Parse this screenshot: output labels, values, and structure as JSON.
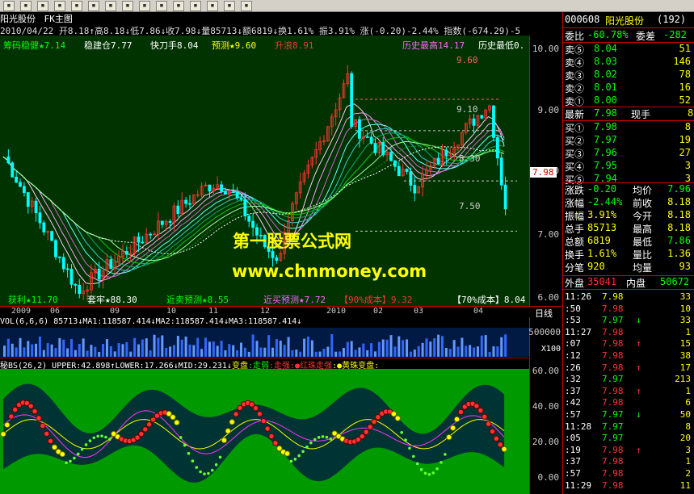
{
  "toolbar": {
    "buttons": [
      "back-icon",
      "forward-icon",
      "period-icon",
      "bars-icon",
      "zoom-in-icon",
      "zoom-out-icon",
      "cross-icon",
      "grid-icon",
      "line-icon",
      "rect-icon",
      "text-icon",
      "arrow-icon",
      "color-icon",
      "save-icon",
      "dropdown-icon"
    ]
  },
  "title": {
    "stock": "阳光股份",
    "indicator": "FK主图"
  },
  "info": {
    "text": "2010/04/22 开8.18↑高8.18↓低7.86↓收7.98↓量85713↓额6819↓换1.61% 振3.91% 涨(-0.20)-2.44% 指数(-674.29)-5"
  },
  "main_labels": {
    "row1": [
      {
        "t": "筹码稳健★7.14",
        "c": "#00ff00"
      },
      {
        "t": "稳建仓7.77",
        "c": "#ffffff"
      },
      {
        "t": "快刀手8.04",
        "c": "#ffffff"
      },
      {
        "t": "预测★9.60",
        "c": "#ffff00"
      },
      {
        "t": "升浪8.91",
        "c": "#ff3333"
      },
      {
        "t": "历史最高14.17",
        "c": "#ff66ff"
      },
      {
        "t": "历史最低0.",
        "c": "#ffffff"
      }
    ],
    "level_top": "9.60",
    "level_mid": "9.10",
    "level_83": "8.30",
    "level_low": "7.50",
    "bottom_row": [
      {
        "t": "获利★11.70",
        "c": "#00ff00"
      },
      {
        "t": "套牢★88.30",
        "c": "#ffffff"
      },
      {
        "t": "近卖预测★8.55",
        "c": "#00ff00"
      },
      {
        "t": "近买预测★7.72",
        "c": "#ff66ff"
      },
      {
        "t": "【90%成本】9.32",
        "c": "#ff3333"
      },
      {
        "t": "【70%成本】8.04",
        "c": "#ffffff"
      }
    ],
    "current_price_tag": "7.98"
  },
  "watermark": {
    "line1": "第一股票公式网",
    "line2": "www.chnmoney.com"
  },
  "y_axis_main": [
    "10.00",
    "9.00",
    "8.00",
    "7.00",
    "6.00"
  ],
  "date_axis": {
    "labels": [
      "2009",
      "06",
      "09",
      "10",
      "11",
      "12",
      "2010",
      "02",
      "03",
      "04"
    ],
    "period": "日线"
  },
  "vol": {
    "text": "VOL(6,6,6) 85713↓MA1:118587.414↓MA2:118587.414↓MA3:118587.414↓",
    "axis": "500000",
    "unit": "X100"
  },
  "bs": {
    "text_prefix": "秘BS(26,2) UPPER:42.898↑LOWER:17.266↓MID:29.231↓",
    "text_a": "变盘",
    "text_b": ":走弱",
    "text_c": ":走强",
    "text_d": ":●红珠走强",
    "text_e": ":●黄珠变盘:",
    "axis": [
      "60.00",
      "40.00",
      "20.00",
      "0.00"
    ]
  },
  "quote": {
    "code": "000608",
    "name": "阳光股份",
    "num": "(192)",
    "weibi_label": "委比",
    "weibi": "-60.78%",
    "weicha_label": "委差",
    "weicha": "-282",
    "sells": [
      {
        "label": "卖⑤",
        "price": "8.04",
        "vol": "51"
      },
      {
        "label": "卖④",
        "price": "8.03",
        "vol": "146"
      },
      {
        "label": "卖③",
        "price": "8.02",
        "vol": "78"
      },
      {
        "label": "卖②",
        "price": "8.01",
        "vol": "16"
      },
      {
        "label": "卖①",
        "price": "8.00",
        "vol": "52"
      }
    ],
    "latest_label": "最新",
    "latest": "7.98",
    "xianshou_label": "现手",
    "xianshou": "8",
    "buys": [
      {
        "label": "买①",
        "price": "7.98",
        "vol": "8"
      },
      {
        "label": "买②",
        "price": "7.97",
        "vol": "19"
      },
      {
        "label": "买③",
        "price": "7.96",
        "vol": "27"
      },
      {
        "label": "买④",
        "price": "7.95",
        "vol": "3"
      },
      {
        "label": "买⑤",
        "price": "7.94",
        "vol": "3"
      }
    ],
    "stats": [
      {
        "l1": "涨跌",
        "v1": "-0.20",
        "l2": "均价",
        "v2": "7.96"
      },
      {
        "l1": "涨幅",
        "v1": "-2.44%",
        "l2": "前收",
        "v2": "8.18"
      },
      {
        "l1": "振幅",
        "v1": "3.91%",
        "l2": "今开",
        "v2": "8.18"
      },
      {
        "l1": "总手",
        "v1": "85713",
        "l2": "最高",
        "v2": "8.18"
      },
      {
        "l1": "总额",
        "v1": "6819",
        "l2": "最低",
        "v2": "7.86"
      },
      {
        "l1": "换手",
        "v1": "1.61%",
        "l2": "量比",
        "v2": "1.36"
      },
      {
        "l1": "分笔",
        "v1": "920",
        "l2": "均量",
        "v2": "93"
      }
    ],
    "waipan_label": "外盘",
    "waipan": "35041",
    "neipan_label": "内盘",
    "neipan": "50672"
  },
  "ticks": [
    {
      "time": "11:26",
      "price": "7.98",
      "vol": "33",
      "arrow": "",
      "c": "#ffff00"
    },
    {
      "time": ":50",
      "price": "7.98",
      "vol": "10",
      "arrow": "",
      "c": "#ff3333"
    },
    {
      "time": ":53",
      "price": "7.97",
      "vol": "33",
      "arrow": "↓",
      "c": "#00ff00"
    },
    {
      "time": "11:27",
      "price": "7.98",
      "vol": "1",
      "arrow": "",
      "c": "#ff3333"
    },
    {
      "time": ":07",
      "price": "7.98",
      "vol": "15",
      "arrow": "↑",
      "c": "#ff3333"
    },
    {
      "time": ":12",
      "price": "7.98",
      "vol": "38",
      "arrow": "",
      "c": "#ff3333"
    },
    {
      "time": ":26",
      "price": "7.98",
      "vol": "17",
      "arrow": "↑",
      "c": "#ff3333"
    },
    {
      "time": ":32",
      "price": "7.97",
      "vol": "213",
      "arrow": "",
      "c": "#00ff00"
    },
    {
      "time": ":37",
      "price": "7.98",
      "vol": "1",
      "arrow": "↑",
      "c": "#ff3333"
    },
    {
      "time": ":42",
      "price": "7.98",
      "vol": "6",
      "arrow": "",
      "c": "#ff3333"
    },
    {
      "time": ":57",
      "price": "7.97",
      "vol": "50",
      "arrow": "↓",
      "c": "#00ff00"
    },
    {
      "time": "11:28",
      "price": "7.97",
      "vol": "8",
      "arrow": "",
      "c": "#00ff00"
    },
    {
      "time": ":05",
      "price": "7.97",
      "vol": "20",
      "arrow": "",
      "c": "#00ff00"
    },
    {
      "time": ":19",
      "price": "7.98",
      "vol": "3",
      "arrow": "↑",
      "c": "#ff3333"
    },
    {
      "time": ":37",
      "price": "7.98",
      "vol": "1",
      "arrow": "",
      "c": "#ff3333"
    },
    {
      "time": ":57",
      "price": "7.98",
      "vol": "2",
      "arrow": "",
      "c": "#ff3333"
    },
    {
      "time": "11:29",
      "price": "7.98",
      "vol": "11",
      "arrow": "",
      "c": "#ff3333"
    }
  ]
}
